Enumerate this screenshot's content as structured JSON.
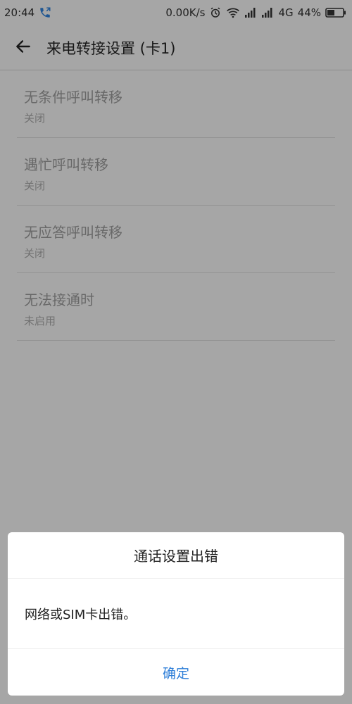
{
  "status_bar": {
    "time": "20:44",
    "network_speed": "0.00K/s",
    "network_type": "4G",
    "battery": "44%",
    "icons": [
      "phone-call-icon",
      "alarm-icon",
      "wifi-icon",
      "signal-icon",
      "signal-icon",
      "battery-icon"
    ]
  },
  "app_bar": {
    "title": "来电转接设置 (卡1)",
    "back_icon": "back-arrow-icon"
  },
  "settings": {
    "items": [
      {
        "title": "无条件呼叫转移",
        "status": "关闭"
      },
      {
        "title": "遇忙呼叫转移",
        "status": "关闭"
      },
      {
        "title": "无应答呼叫转移",
        "status": "关闭"
      },
      {
        "title": "无法接通时",
        "status": "未启用"
      }
    ]
  },
  "dialog": {
    "title": "通话设置出错",
    "message": "网络或SIM卡出错。",
    "confirm_label": "确定"
  },
  "colors": {
    "accent": "#2f7fd8",
    "background": "#f5f5f5",
    "overlay": "rgba(0,0,0,0.32)"
  }
}
